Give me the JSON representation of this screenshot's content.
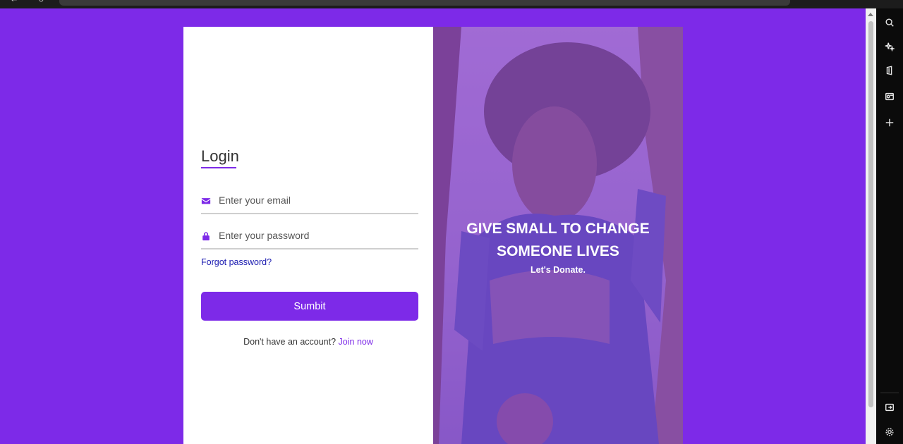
{
  "login": {
    "title": "Login",
    "email": {
      "placeholder": "Enter your email",
      "value": ""
    },
    "password": {
      "placeholder": "Enter your password",
      "value": ""
    },
    "forgot_label": "Forgot password?",
    "submit_label": "Sumbit",
    "signup_prompt": "Don't have an account?",
    "join_label": "Join now"
  },
  "hero": {
    "heading_line1": "GIVE SMALL TO CHANGE",
    "heading_line2": "SOMEONE LIVES",
    "subheading": "Let's Donate."
  },
  "colors": {
    "background": "#7d2ae8",
    "accent": "#7d2ae8",
    "link": "#1a1ab0"
  },
  "icons": {
    "email": "envelope-icon",
    "password": "lock-icon",
    "sidebar": [
      "search-icon",
      "sparkle-icon",
      "office-icon",
      "outlook-icon",
      "add-icon",
      "panel-icon",
      "gear-icon"
    ]
  }
}
